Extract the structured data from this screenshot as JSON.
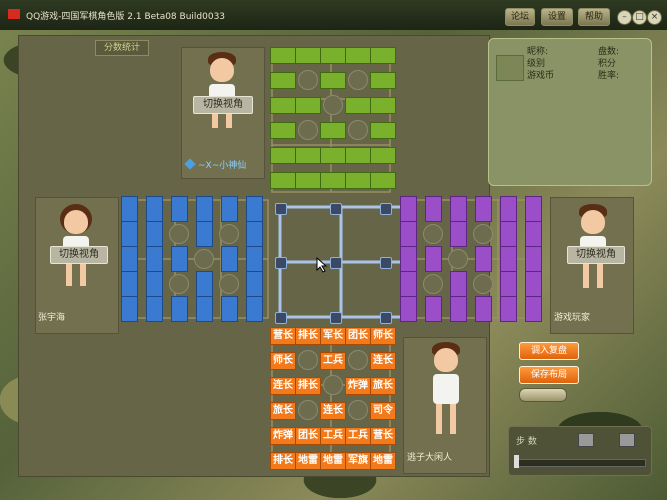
{
  "window": {
    "title": "QQ游戏-四国军棋角色版 2.1 Beta08 Build0033"
  },
  "titlebar": {
    "buttons": [
      "论坛",
      "设置",
      "帮助"
    ],
    "window_controls": [
      "–",
      "□",
      "×"
    ]
  },
  "tabs": {
    "stats": "分数统计"
  },
  "players": {
    "top": {
      "switch_label": "切换视角",
      "name": "~X~小神仙"
    },
    "left": {
      "switch_label": "切换视角",
      "name": "张宇海"
    },
    "right": {
      "switch_label": "切换视角",
      "name": "游戏玩家"
    },
    "bottom": {
      "name": "逃子大闲人"
    }
  },
  "info_panel": {
    "labels": {
      "nickname": "昵称:",
      "level": "级别",
      "coins": "游戏币",
      "rounds": "盘数:",
      "score": "积分",
      "winrate": "胜率:"
    }
  },
  "actions": {
    "load_replay": "调入复盘",
    "save_layout": "保存布局",
    "third": ""
  },
  "steps": {
    "label": "步  数"
  },
  "my_pieces": [
    [
      "营长",
      "排长",
      "军长",
      "团长",
      "师长"
    ],
    [
      "师长",
      "",
      "工兵",
      "",
      "连长"
    ],
    [
      "连长",
      "排长",
      "",
      "炸弹",
      "旅长"
    ],
    [
      "旅长",
      "",
      "连长",
      "",
      "司令"
    ],
    [
      "炸弹",
      "团长",
      "工兵",
      "工兵",
      "营长"
    ],
    [
      "排长",
      "地雷",
      "地雷",
      "军旗",
      "地雷"
    ]
  ],
  "colors": {
    "green": "#7ab12c",
    "blue": "#3a7ad0",
    "purple": "#9a4fc8",
    "orange": "#f27a1b"
  }
}
